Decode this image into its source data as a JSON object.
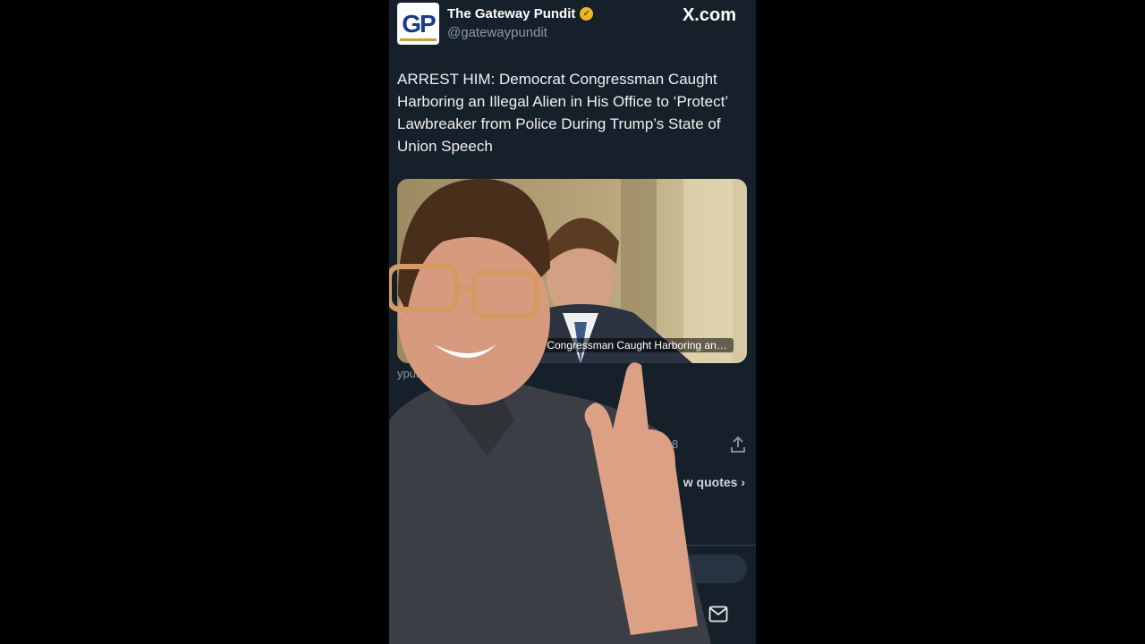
{
  "tweet": {
    "account_name": "The Gateway Pundit",
    "account_handle": "@gatewaypundit",
    "logo_text": "GP",
    "brand": "X.com",
    "headline": "ARREST HIM: Democrat Congressman Caught Harboring an Illegal Alien in His Office to ‘Protect’ Lawbreaker from Police During Trump’s State of Union Speech",
    "media_caption": "at Congressman Caught Harboring an Il...",
    "link_domain": "ypundit.com",
    "stat_count": "8",
    "quotes_label": "w quotes"
  },
  "icons": {
    "verified": "verified-badge-icon",
    "share": "share-icon",
    "mail": "mail-icon",
    "chevron": "chevron-right-icon"
  },
  "colors": {
    "background": "#15202b",
    "text_secondary": "#8b98a5",
    "verified_badge": "#e8b923",
    "logo_blue": "#1a3a8c"
  }
}
